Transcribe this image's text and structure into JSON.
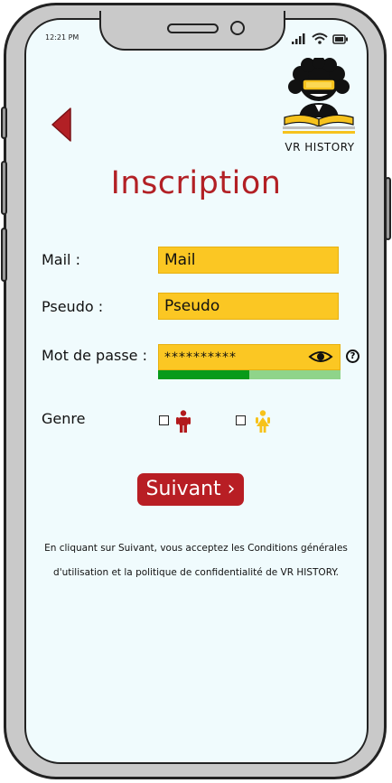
{
  "status_bar": {
    "time": "12:21 PM"
  },
  "header": {
    "back_icon": "back-arrow-icon",
    "logo_text": "VR HISTORY"
  },
  "title": "Inscription",
  "form": {
    "mail": {
      "label": "Mail :",
      "value": "Mail"
    },
    "pseudo": {
      "label": "Pseudo :",
      "value": "Pseudo"
    },
    "password": {
      "label": "Mot de passe :",
      "value": "**********",
      "strength": 0.5,
      "toggle_icon": "eye-icon",
      "help_icon": "help-icon"
    },
    "genre": {
      "label": "Genre",
      "options": [
        {
          "icon": "male-icon",
          "color": "#b2191c"
        },
        {
          "icon": "female-icon",
          "color": "#f7c21a"
        }
      ]
    }
  },
  "next_button": {
    "label": "Suivant ›"
  },
  "terms": {
    "line1": "En cliquant sur Suivant, vous acceptez les Conditions générales",
    "line2": "d'utilisation et la politique de confidentialité de VR HISTORY."
  },
  "colors": {
    "accent": "#b22025",
    "field": "#fbc723",
    "strength_strong": "#089b1a",
    "strength_weak": "#8fd48a",
    "screen": "#f0fbfd"
  }
}
